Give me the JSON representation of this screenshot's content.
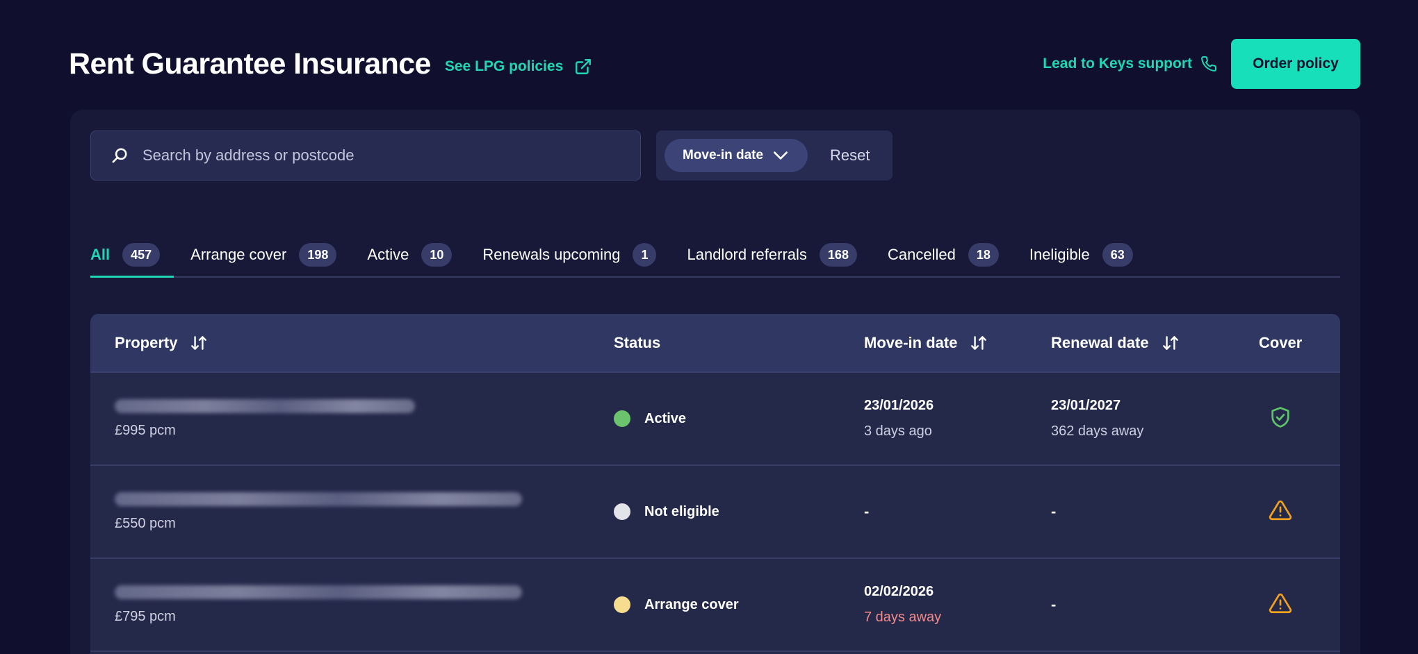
{
  "header": {
    "title": "Rent Guarantee Insurance",
    "lpg_link": "See LPG policies",
    "support_link": "Lead to Keys support",
    "order_button": "Order policy"
  },
  "search": {
    "placeholder": "Search by address or postcode",
    "value": ""
  },
  "filters": {
    "movein_label": "Move-in date",
    "reset_label": "Reset"
  },
  "tabs": [
    {
      "label": "All",
      "count": "457",
      "active": true
    },
    {
      "label": "Arrange cover",
      "count": "198"
    },
    {
      "label": "Active",
      "count": "10"
    },
    {
      "label": "Renewals upcoming",
      "count": "1"
    },
    {
      "label": "Landlord referrals",
      "count": "168"
    },
    {
      "label": "Cancelled",
      "count": "18"
    },
    {
      "label": "Ineligible",
      "count": "63"
    }
  ],
  "table": {
    "columns": {
      "property": "Property",
      "status": "Status",
      "movein": "Move-in date",
      "renewal": "Renewal date",
      "cover": "Cover"
    },
    "rows": [
      {
        "rent": "£995 pcm",
        "status": "Active",
        "status_color": "#6bc46d",
        "movein_date": "23/01/2026",
        "movein_sub": "3 days ago",
        "renewal_date": "23/01/2027",
        "renewal_sub": "362 days away",
        "cover_icon": "shield-check-icon"
      },
      {
        "rent": "£550 pcm",
        "status": "Not eligible",
        "status_color": "#e3e3ea",
        "movein_date": "-",
        "renewal_date": "-",
        "cover_icon": "warning-icon"
      },
      {
        "rent": "£795 pcm",
        "status": "Arrange cover",
        "status_color": "#f6dc8f",
        "movein_date": "02/02/2026",
        "movein_sub": "7 days away",
        "renewal_date": "-",
        "cover_icon": "warning-icon"
      }
    ]
  },
  "colors": {
    "accent": "#20d7b4",
    "background": "#110f2e",
    "warning": "#f0a11e",
    "shield": "#5fc46a"
  }
}
